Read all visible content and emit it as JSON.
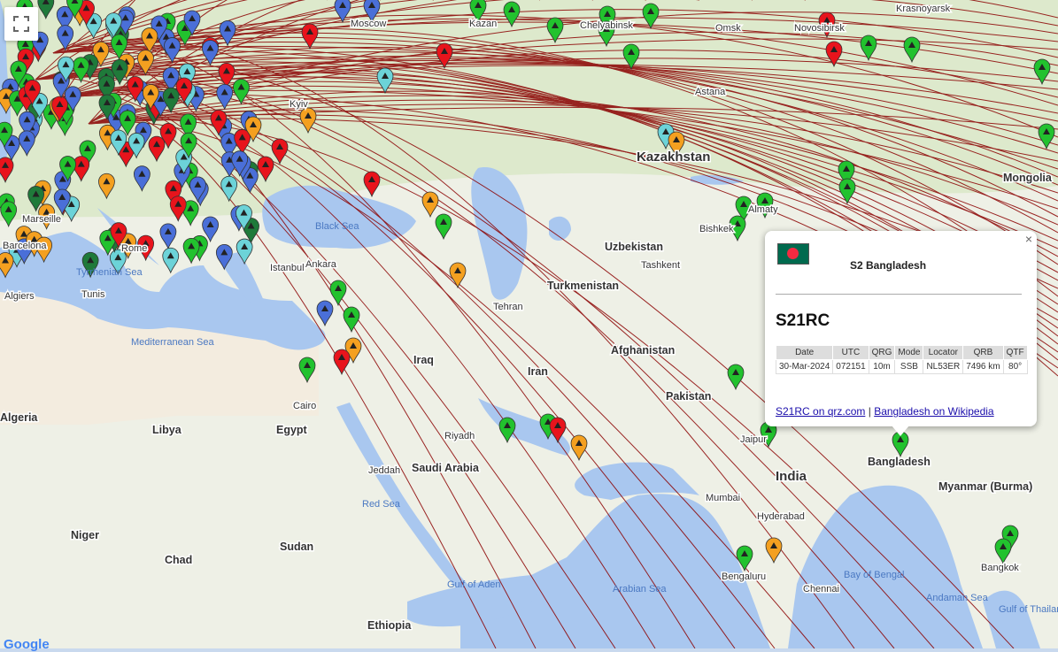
{
  "map_controls": {
    "fullscreen_icon": "fullscreen-icon"
  },
  "labels": {
    "countries_large": [
      "Kazakhstan",
      "Uzbekistan",
      "Turkmenistan",
      "Afghanistan",
      "Pakistan",
      "India",
      "Iran",
      "Iraq",
      "Saudi Arabia",
      "Egypt",
      "Libya",
      "Niger",
      "Chad",
      "Sudan",
      "Algeria",
      "Ethiopia",
      "Mongolia",
      "Myanmar (Burma)",
      "Bangladesh"
    ],
    "cities": [
      "Moscow",
      "Kazan",
      "Chelyabinsk",
      "Omsk",
      "Novosibirsk",
      "Krasnoyarsk",
      "Astana",
      "Tashkent",
      "Bishkek",
      "Almaty",
      "Tehran",
      "Riyadh",
      "Jeddah",
      "Cairo",
      "Istanbul",
      "Ankara",
      "Algiers",
      "Tunis",
      "Rome",
      "Marseille",
      "Barcelona",
      "Kyiv",
      "Mumbai",
      "Hyderabad",
      "Bengaluru",
      "Chennai",
      "Bangkok",
      "Jaipur"
    ],
    "seas": [
      "Black Sea",
      "Mediterranean Sea",
      "Red Sea",
      "Arabian Sea",
      "Bay of Bengal",
      "Gulf of Aden",
      "Andaman Sea",
      "Gulf of Thailand",
      "Tyrrhenian Sea"
    ]
  },
  "popup": {
    "country": "S2 Bangladesh",
    "callsign": "S21RC",
    "close": "×",
    "table": {
      "headers": [
        "Date",
        "UTC",
        "QRG",
        "Mode",
        "Locator",
        "QRB",
        "QTF"
      ],
      "row": [
        "30-Mar-2024",
        "072151",
        "10m",
        "SSB",
        "NL53ER",
        "7496 km",
        "80°"
      ]
    },
    "link1": "S21RC on qrz.com",
    "separator": "|",
    "link2": "Bangladesh on Wikipedia"
  },
  "attribution": "Google",
  "colors": {
    "path": "#8b0000",
    "marker_red": "#e8141c",
    "marker_blue": "#4a6fd8",
    "marker_green": "#22c22e",
    "marker_orange": "#f4a020",
    "marker_cyan": "#6cd3d8",
    "marker_darkgreen": "#1f7a3a",
    "land": "#f2efe9",
    "water": "#a9c7ef"
  }
}
